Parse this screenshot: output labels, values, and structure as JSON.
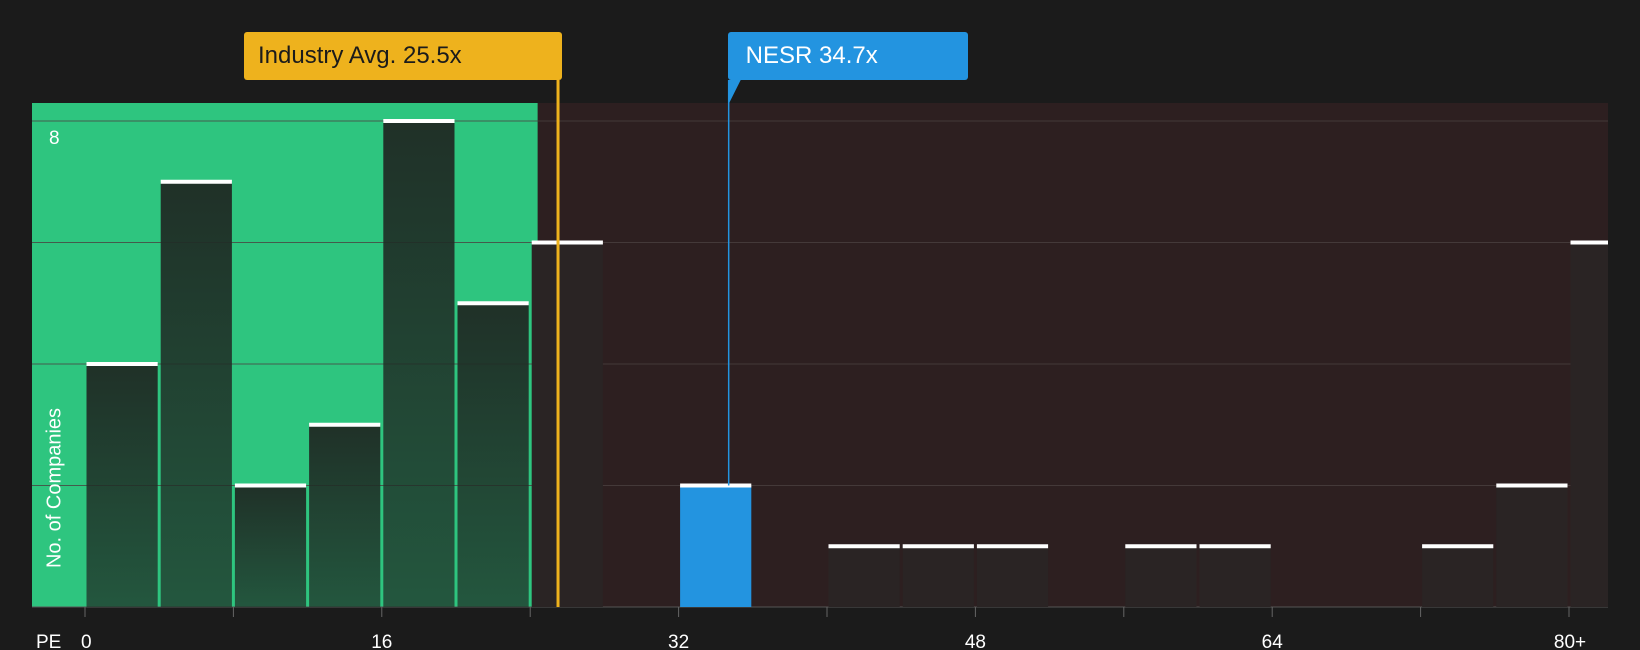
{
  "colors": {
    "background": "#1b1b1b",
    "below_zone": "#2ec57f",
    "above_zone": "#2d1f20",
    "bar": "#1f2c25",
    "bar_above": "#2a2424",
    "company": "#2394e0",
    "industry": "#eeb21d",
    "bar_cap": "#ffffff",
    "gridline": "#4a4040"
  },
  "chart_data": {
    "type": "bar",
    "xlabel": "PE",
    "ylabel": "No. of Companies",
    "x_ticks": [
      "0",
      "16",
      "32",
      "48",
      "64",
      "80+"
    ],
    "y_ticks": [
      "8"
    ],
    "ylim": [
      0,
      8
    ],
    "bin_width": 4,
    "bins": [
      {
        "from": 0,
        "to": 4,
        "count": 4
      },
      {
        "from": 4,
        "to": 8,
        "count": 7
      },
      {
        "from": 8,
        "to": 12,
        "count": 2
      },
      {
        "from": 12,
        "to": 16,
        "count": 3
      },
      {
        "from": 16,
        "to": 20,
        "count": 8
      },
      {
        "from": 20,
        "to": 24,
        "count": 5
      },
      {
        "from": 24,
        "to": 28,
        "count": 6
      },
      {
        "from": 28,
        "to": 32,
        "count": 0
      },
      {
        "from": 32,
        "to": 36,
        "count": 2
      },
      {
        "from": 36,
        "to": 40,
        "count": 0
      },
      {
        "from": 40,
        "to": 44,
        "count": 1
      },
      {
        "from": 44,
        "to": 48,
        "count": 1
      },
      {
        "from": 48,
        "to": 52,
        "count": 1
      },
      {
        "from": 52,
        "to": 56,
        "count": 0
      },
      {
        "from": 56,
        "to": 60,
        "count": 1
      },
      {
        "from": 60,
        "to": 64,
        "count": 1
      },
      {
        "from": 64,
        "to": 68,
        "count": 0
      },
      {
        "from": 68,
        "to": 72,
        "count": 0
      },
      {
        "from": 72,
        "to": 76,
        "count": 1
      },
      {
        "from": 76,
        "to": 80,
        "count": 2
      },
      {
        "from": 80,
        "to": 84,
        "count": 6
      }
    ],
    "company_bin_index": 8,
    "industry_avg": {
      "label": "Industry Avg. 25.5x",
      "value": 25.5
    },
    "company": {
      "label": "NESR 34.7x",
      "value": 34.7
    },
    "below_zone_until": 24.4
  }
}
